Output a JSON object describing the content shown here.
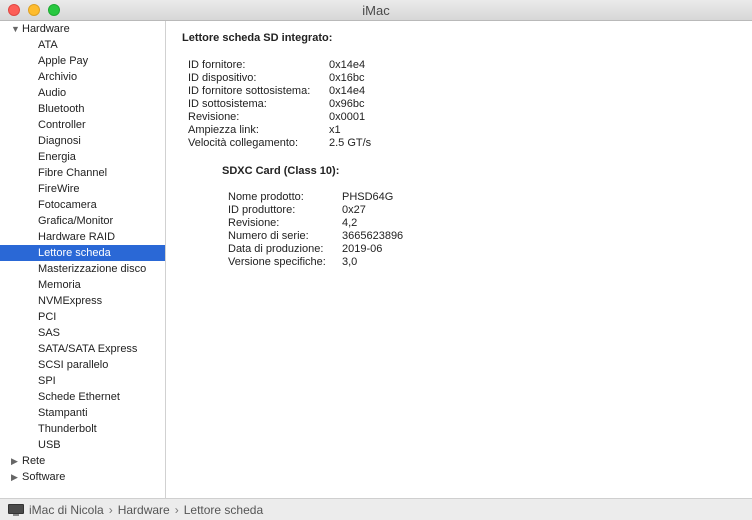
{
  "window": {
    "title": "iMac"
  },
  "sidebar": {
    "groups": [
      {
        "label": "Hardware",
        "expanded": true,
        "items": [
          "ATA",
          "Apple Pay",
          "Archivio",
          "Audio",
          "Bluetooth",
          "Controller",
          "Diagnosi",
          "Energia",
          "Fibre Channel",
          "FireWire",
          "Fotocamera",
          "Grafica/Monitor",
          "Hardware RAID",
          "Lettore scheda",
          "Masterizzazione disco",
          "Memoria",
          "NVMExpress",
          "PCI",
          "SAS",
          "SATA/SATA Express",
          "SCSI parallelo",
          "SPI",
          "Schede Ethernet",
          "Stampanti",
          "Thunderbolt",
          "USB"
        ],
        "selected": "Lettore scheda"
      },
      {
        "label": "Rete",
        "expanded": false
      },
      {
        "label": "Software",
        "expanded": false
      }
    ]
  },
  "content": {
    "section_title": "Lettore scheda SD integrato:",
    "properties": [
      {
        "key": "ID fornitore:",
        "value": "0x14e4"
      },
      {
        "key": "ID dispositivo:",
        "value": "0x16bc"
      },
      {
        "key": "ID fornitore sottosistema:",
        "value": "0x14e4"
      },
      {
        "key": "ID sottosistema:",
        "value": "0x96bc"
      },
      {
        "key": "Revisione:",
        "value": "0x0001"
      },
      {
        "key": "Ampiezza link:",
        "value": "x1"
      },
      {
        "key": "Velocità collegamento:",
        "value": "2.5 GT/s"
      }
    ],
    "card_title": "SDXC Card (Class 10):",
    "card_properties": [
      {
        "key": "Nome prodotto:",
        "value": "PHSD64G"
      },
      {
        "key": "ID produttore:",
        "value": "0x27"
      },
      {
        "key": "Revisione:",
        "value": "4,2"
      },
      {
        "key": "Numero di serie:",
        "value": "3665623896"
      },
      {
        "key": "Data di produzione:",
        "value": "2019-06"
      },
      {
        "key": "Versione specifiche:",
        "value": "3,0"
      }
    ]
  },
  "pathbar": {
    "items": [
      "iMac di Nicola",
      "Hardware",
      "Lettore scheda"
    ],
    "separator": "›"
  },
  "icons": {
    "close": "close-button",
    "minimize": "minimize-button",
    "zoom": "zoom-button",
    "computer": "imac-icon",
    "disclosure_open": "▼",
    "disclosure_closed": "▶"
  },
  "colors": {
    "selection": "#2a68d6",
    "close": "#fd5e57",
    "minimize": "#febc2e",
    "zoom": "#28c840"
  }
}
